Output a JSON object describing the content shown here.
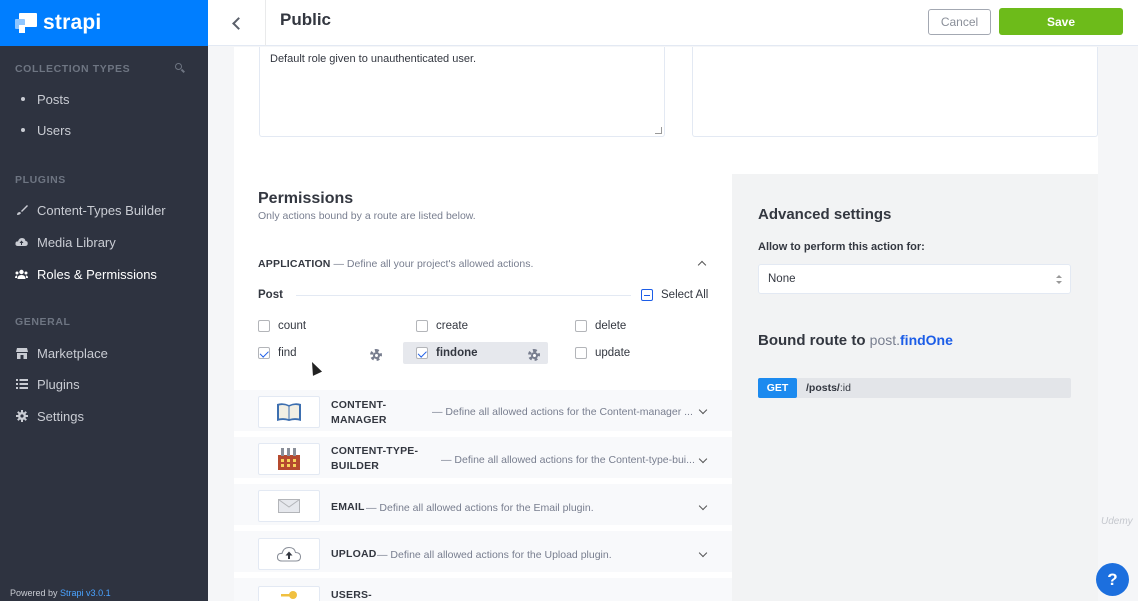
{
  "app": {
    "logo_text": "strapi",
    "brand_color": "#007eff"
  },
  "sidebar": {
    "collection_types_title": "COLLECTION TYPES",
    "collection_types": [
      {
        "label": "Posts"
      },
      {
        "label": "Users"
      }
    ],
    "plugins_title": "PLUGINS",
    "plugins": [
      {
        "label": "Content-Types Builder",
        "icon": "paintbrush-icon"
      },
      {
        "label": "Media Library",
        "icon": "cloud-upload-icon"
      },
      {
        "label": "Roles & Permissions",
        "icon": "users-icon",
        "active": true
      }
    ],
    "general_title": "GENERAL",
    "general": [
      {
        "label": "Marketplace",
        "icon": "shop-icon"
      },
      {
        "label": "Plugins",
        "icon": "list-icon"
      },
      {
        "label": "Settings",
        "icon": "gear-icon"
      }
    ],
    "powered_by": "Powered by",
    "powered_version": "Strapi v3.0.1"
  },
  "header": {
    "title": "Public",
    "cancel_label": "Cancel",
    "save_label": "Save",
    "save_color": "#6dbb1a"
  },
  "form": {
    "description_value": "Default role given to unauthenticated user."
  },
  "permissions": {
    "title": "Permissions",
    "subtitle": "Only actions bound by a route are listed below.",
    "application": {
      "name": "APPLICATION",
      "description": " — Define all your project's allowed actions."
    },
    "controller": "Post",
    "select_all_label": "Select All",
    "actions": [
      {
        "label": "count",
        "checked": false
      },
      {
        "label": "create",
        "checked": false
      },
      {
        "label": "delete",
        "checked": false
      },
      {
        "label": "find",
        "checked": true
      },
      {
        "label": "findone",
        "checked": true,
        "selected": true
      },
      {
        "label": "update",
        "checked": false
      }
    ],
    "plugins": [
      {
        "name_1": "CONTENT-",
        "name_2": "MANAGER",
        "description": "— Define all allowed actions for the Content-manager ...",
        "icon": "book-icon"
      },
      {
        "name_1": "CONTENT-TYPE-",
        "name_2": "BUILDER",
        "description": "— Define all allowed actions for the Content-type-bui...",
        "icon": "factory-icon"
      },
      {
        "name_1": "EMAIL",
        "description": "— Define all allowed actions for the Email plugin.",
        "icon": "envelope-icon"
      },
      {
        "name_1": "UPLOAD",
        "description": "— Define all allowed actions for the Upload plugin.",
        "icon": "cloud-upload-icon"
      },
      {
        "name_1": "USERS-",
        "description": "",
        "icon": "key-icon"
      }
    ]
  },
  "advanced": {
    "title": "Advanced settings",
    "allow_label": "Allow to perform this action for:",
    "select_value": "None",
    "bound_route_prefix": "Bound route to ",
    "bound_route_model": "post.",
    "bound_route_action": "findOne",
    "route_method": "GET",
    "route_path_prefix": "/posts/",
    "route_path_param": ":id",
    "method_color": "#1c8aef"
  },
  "help": {
    "label": "?"
  },
  "watermark": "Udemy"
}
